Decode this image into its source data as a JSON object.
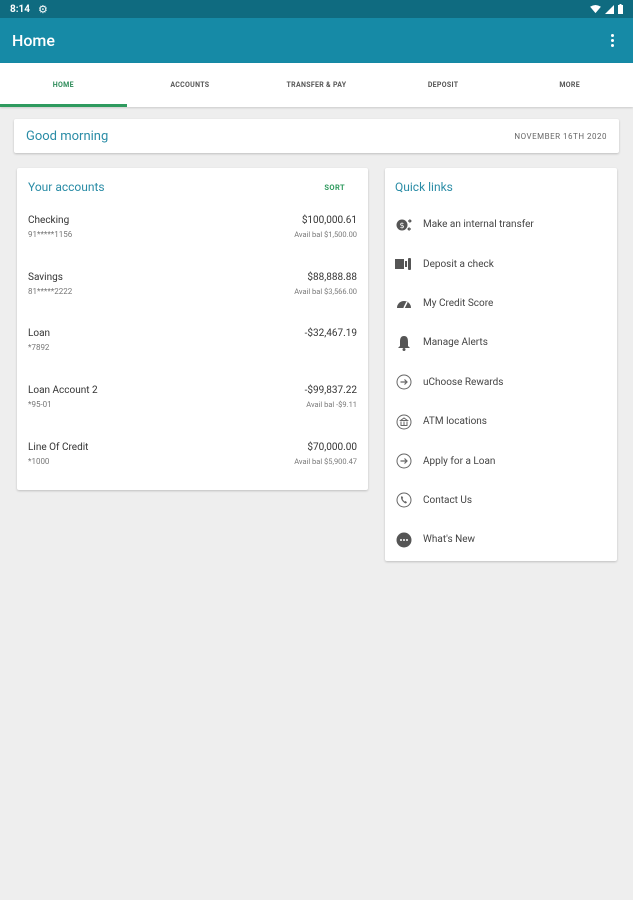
{
  "status_bar": {
    "time": "8:14"
  },
  "app_bar": {
    "title": "Home"
  },
  "tabs": [
    {
      "label": "HOME"
    },
    {
      "label": "ACCOUNTS"
    },
    {
      "label": "TRANSFER & PAY"
    },
    {
      "label": "DEPOSIT"
    },
    {
      "label": "MORE"
    }
  ],
  "greeting": {
    "text": "Good morning",
    "date": "NOVEMBER 16TH 2020"
  },
  "accounts": {
    "title": "Your accounts",
    "sort_label": "SORT",
    "items": [
      {
        "name": "Checking",
        "number": "91*****1156",
        "balance": "$100,000.61",
        "available": "Avail bal $1,500.00"
      },
      {
        "name": "Savings",
        "number": "81*****2222",
        "balance": "$88,888.88",
        "available": "Avail bal $3,566.00"
      },
      {
        "name": "Loan",
        "number": "*7892",
        "balance": "-$32,467.19",
        "available": ""
      },
      {
        "name": "Loan Account 2",
        "number": "*95-01",
        "balance": "-$99,837.22",
        "available": "Avail bal -$9.11"
      },
      {
        "name": "Line Of Credit",
        "number": "*1000",
        "balance": "$70,000.00",
        "available": "Avail bal $5,900.47"
      }
    ]
  },
  "quick_links": {
    "title": "Quick links",
    "items": [
      {
        "label": "Make an internal transfer",
        "icon": "transfer-icon"
      },
      {
        "label": "Deposit a check",
        "icon": "check-deposit-icon"
      },
      {
        "label": "My Credit Score",
        "icon": "gauge-icon"
      },
      {
        "label": "Manage Alerts",
        "icon": "bell-icon"
      },
      {
        "label": "uChoose Rewards",
        "icon": "arrow-circle-icon"
      },
      {
        "label": "ATM locations",
        "icon": "bank-icon"
      },
      {
        "label": "Apply for a Loan",
        "icon": "arrow-circle-icon"
      },
      {
        "label": "Contact Us",
        "icon": "phone-icon"
      },
      {
        "label": "What's New",
        "icon": "chat-icon"
      }
    ]
  },
  "colors": {
    "primary": "#168aa6",
    "status_bar": "#0f6b80",
    "accent_green": "#2e9a5e",
    "link_blue": "#2a8ca6"
  }
}
